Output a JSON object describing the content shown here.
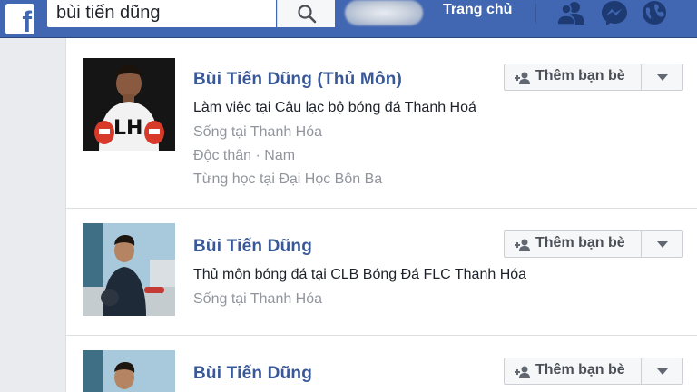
{
  "header": {
    "logo_letter": "f",
    "search_value": "bùi tiến dũng",
    "home_label": "Trang chủ",
    "icons": [
      "facebook-logo-icon",
      "search-icon",
      "friends-icon",
      "messenger-icon",
      "globe-icon"
    ],
    "brand_color": "#4267b2"
  },
  "results": [
    {
      "name": "Bùi Tiến Dũng (Thủ Môn)",
      "lines": [
        "Làm việc tại Câu lạc bộ bóng đá Thanh Hoá",
        "Sống tại Thanh Hóa",
        "Độc thân · Nam",
        "Từng học tại Đại Học Bôn Ba"
      ],
      "add_friend_label": "Thêm bạn bè"
    },
    {
      "name": "Bùi Tiến Dũng",
      "lines": [
        "Thủ môn bóng đá tại CLB Bóng Đá FLC Thanh Hóa",
        "Sống tại Thanh Hóa"
      ],
      "add_friend_label": "Thêm bạn bè"
    },
    {
      "name": "Bùi Tiến Dũng",
      "lines": [],
      "add_friend_label": "Thêm bạn bè"
    }
  ]
}
